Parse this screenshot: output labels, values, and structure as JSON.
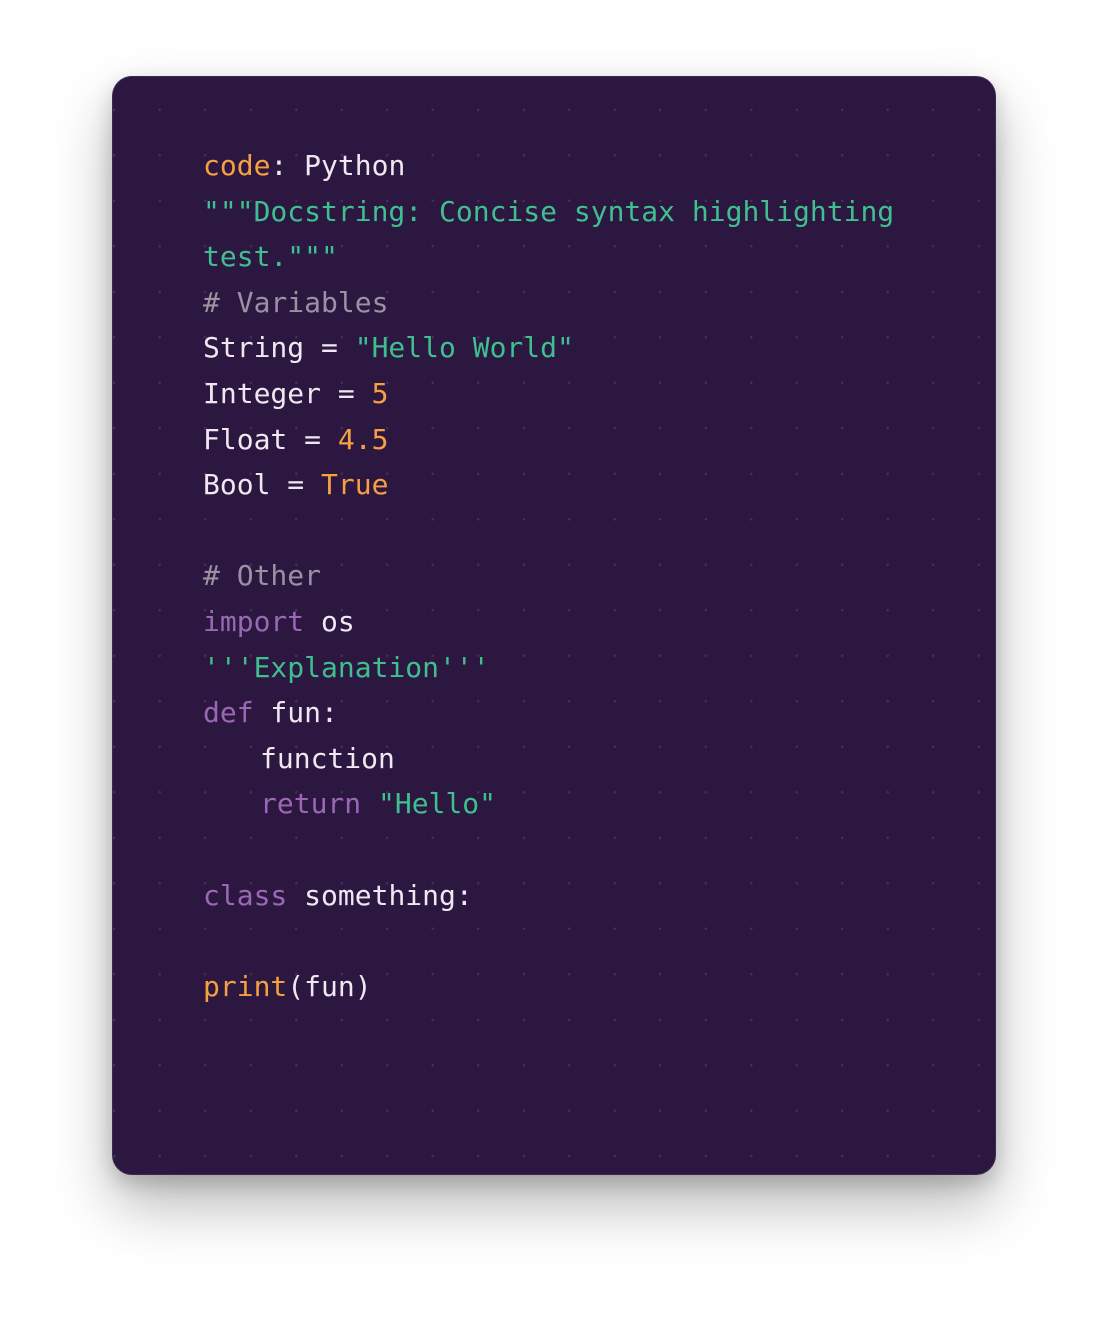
{
  "lines": [
    {
      "tokens": [
        {
          "k": "key",
          "t": "code"
        },
        {
          "k": "txt",
          "t": ": Python"
        }
      ]
    },
    {
      "tokens": [
        {
          "k": "doc",
          "t": "\"\"\"Docstring: Concise syntax highlighting"
        }
      ]
    },
    {
      "tokens": [
        {
          "k": "doc",
          "t": "test.\"\"\""
        }
      ]
    },
    {
      "tokens": [
        {
          "k": "com",
          "t": "# Variables"
        }
      ]
    },
    {
      "tokens": [
        {
          "k": "txt",
          "t": "String = "
        },
        {
          "k": "str",
          "t": "\"Hello World\""
        }
      ]
    },
    {
      "tokens": [
        {
          "k": "txt",
          "t": "Integer = "
        },
        {
          "k": "num",
          "t": "5"
        }
      ]
    },
    {
      "tokens": [
        {
          "k": "txt",
          "t": "Float = "
        },
        {
          "k": "num",
          "t": "4.5"
        }
      ]
    },
    {
      "tokens": [
        {
          "k": "txt",
          "t": "Bool = "
        },
        {
          "k": "num",
          "t": "True"
        }
      ]
    },
    {
      "tokens": []
    },
    {
      "tokens": [
        {
          "k": "com",
          "t": "# Other"
        }
      ]
    },
    {
      "tokens": [
        {
          "k": "kw",
          "t": "import"
        },
        {
          "k": "txt",
          "t": " os"
        }
      ]
    },
    {
      "tokens": [
        {
          "k": "str",
          "t": "'''Explanation'''"
        }
      ]
    },
    {
      "tokens": [
        {
          "k": "kw",
          "t": "def"
        },
        {
          "k": "txt",
          "t": " fun:"
        }
      ]
    },
    {
      "indent": true,
      "tokens": [
        {
          "k": "txt",
          "t": "function"
        }
      ]
    },
    {
      "indent": true,
      "tokens": [
        {
          "k": "kw",
          "t": "return"
        },
        {
          "k": "txt",
          "t": " "
        },
        {
          "k": "str",
          "t": "\"Hello\""
        }
      ]
    },
    {
      "tokens": []
    },
    {
      "tokens": [
        {
          "k": "kw",
          "t": "class"
        },
        {
          "k": "txt",
          "t": " something:"
        }
      ]
    },
    {
      "tokens": []
    },
    {
      "tokens": [
        {
          "k": "fn",
          "t": "print"
        },
        {
          "k": "txt",
          "t": "(fun)"
        }
      ]
    }
  ],
  "colors": {
    "background": "#2c1740",
    "text": "#f1e7f1",
    "keyword": "#9a67b5",
    "string": "#3fbf8f",
    "number": "#f5a041",
    "comment": "#9b91a1"
  }
}
